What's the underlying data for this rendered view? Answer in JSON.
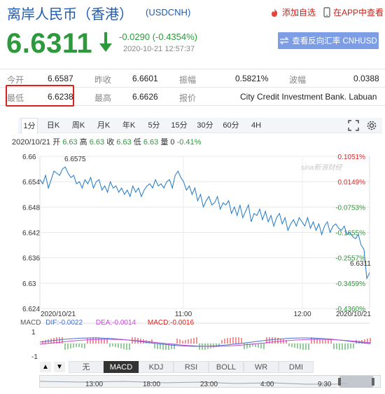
{
  "header": {
    "title": "离岸人民币（香港）",
    "symbol": "(USDCNH)",
    "add_watchlist": "添加自选",
    "app_view": "在APP中查看"
  },
  "quote": {
    "price": "6.6311",
    "change": "-0.0290 (-0.4354%)",
    "time": "2020-10-21 12:57:37",
    "reverse_button": "查看反向汇率 CNHUSD"
  },
  "stats": {
    "open_label": "今开",
    "open": "6.6587",
    "prev_close_label": "昨收",
    "prev_close": "6.6601",
    "amplitude_label": "振幅",
    "amplitude": "0.5821%",
    "wave_label": "波幅",
    "wave": "0.0388",
    "low_label": "最低",
    "low": "6.6238",
    "high_label": "最高",
    "high": "6.6626",
    "quote_label": "报价",
    "quote_source": "City Credit Investment Bank. Labuan"
  },
  "tabs": [
    "1分",
    "日K",
    "周K",
    "月K",
    "年K",
    "5分",
    "15分",
    "30分",
    "60分",
    "4H"
  ],
  "info_line": {
    "date": "2020/10/21",
    "open_label": "开",
    "open": "6.63",
    "high_label": "高",
    "high": "6.63",
    "close_label": "收",
    "close": "6.63",
    "low_label": "低",
    "low": "6.63",
    "volume_label": "量",
    "volume": "0",
    "change_pct": "-0.41%"
  },
  "watermark": "sina新浪财经",
  "colors": {
    "up": "#e3262a",
    "down": "#2c9a3a",
    "line": "#1f78c8",
    "accent": "#1f5cb6"
  },
  "chart_data": {
    "type": "line",
    "y_ticks": [
      "6.66",
      "6.654",
      "6.648",
      "6.642",
      "6.636",
      "6.63",
      "6.624"
    ],
    "y_range": [
      6.624,
      6.66
    ],
    "pct_ticks": [
      "0.1051%",
      "0.0149%",
      "-0.0753%",
      "-0.1655%",
      "-0.2557%",
      "-0.3459%",
      "-0.4360%"
    ],
    "x_ticks": [
      "2020/10/21",
      "11:00",
      "12:00",
      "2020/10/21"
    ],
    "max_label": "6.6575",
    "last_label": "6.6311",
    "series": [
      {
        "values": [
          6.6545,
          6.6535,
          6.6555,
          6.6525,
          6.6545,
          6.6565,
          6.656,
          6.6555,
          6.657,
          6.6575,
          6.656,
          6.655,
          6.6555,
          6.6535,
          6.654,
          6.6525,
          6.6545,
          6.6535,
          6.655,
          6.6525,
          6.654,
          6.6545,
          6.652,
          6.653,
          6.6515,
          6.654,
          6.6525,
          6.653,
          6.6515,
          6.6525,
          6.651,
          6.652,
          6.6505,
          6.653,
          6.6515,
          6.6525,
          6.6505,
          6.652,
          6.653,
          6.6535,
          6.6525,
          6.6545,
          6.653,
          6.6535,
          6.6525,
          6.654,
          6.6545,
          6.6525,
          6.6555,
          6.6565,
          6.655,
          6.654,
          6.652,
          6.653,
          6.651,
          6.6525,
          6.6495,
          6.651,
          6.648,
          6.6495,
          6.6505,
          6.6485,
          6.649,
          6.6505,
          6.6475,
          6.649,
          6.6485,
          6.6495,
          6.6465,
          6.648,
          6.646,
          6.6485,
          6.6455,
          6.647,
          6.6485,
          6.6445,
          6.6465,
          6.646,
          6.6475,
          6.645,
          6.647,
          6.6445,
          6.646,
          6.6435,
          6.6455,
          6.6465,
          6.644,
          6.6455,
          6.6425,
          6.644,
          6.645,
          6.6435,
          6.6455,
          6.6445,
          6.6435,
          6.6455,
          6.643,
          6.6445,
          6.6425,
          6.644,
          6.6415,
          6.6435,
          6.6445,
          6.642,
          6.6435,
          6.644,
          6.643,
          6.6425,
          6.6435,
          6.6415,
          6.642,
          6.641,
          6.6405,
          6.6415,
          6.639,
          6.638,
          6.6311,
          6.6325
        ]
      }
    ]
  },
  "macd": {
    "label": "MACD",
    "dif_label": "DIF:",
    "dif": "-0.0022",
    "dea_label": "DEA:",
    "dea": "-0.0014",
    "macd_label": "MACD:",
    "macd_val": "-0.0016",
    "y_ticks": [
      "1",
      "-1"
    ]
  },
  "indicators": {
    "prev": "▲",
    "next": "▼",
    "items": [
      "无",
      "MACD",
      "KDJ",
      "RSI",
      "BOLL",
      "WR",
      "DMI"
    ],
    "active": "MACD"
  },
  "scroll_ticks": [
    "13:00",
    "18:00",
    "23:00",
    "4:00",
    "9:30"
  ]
}
